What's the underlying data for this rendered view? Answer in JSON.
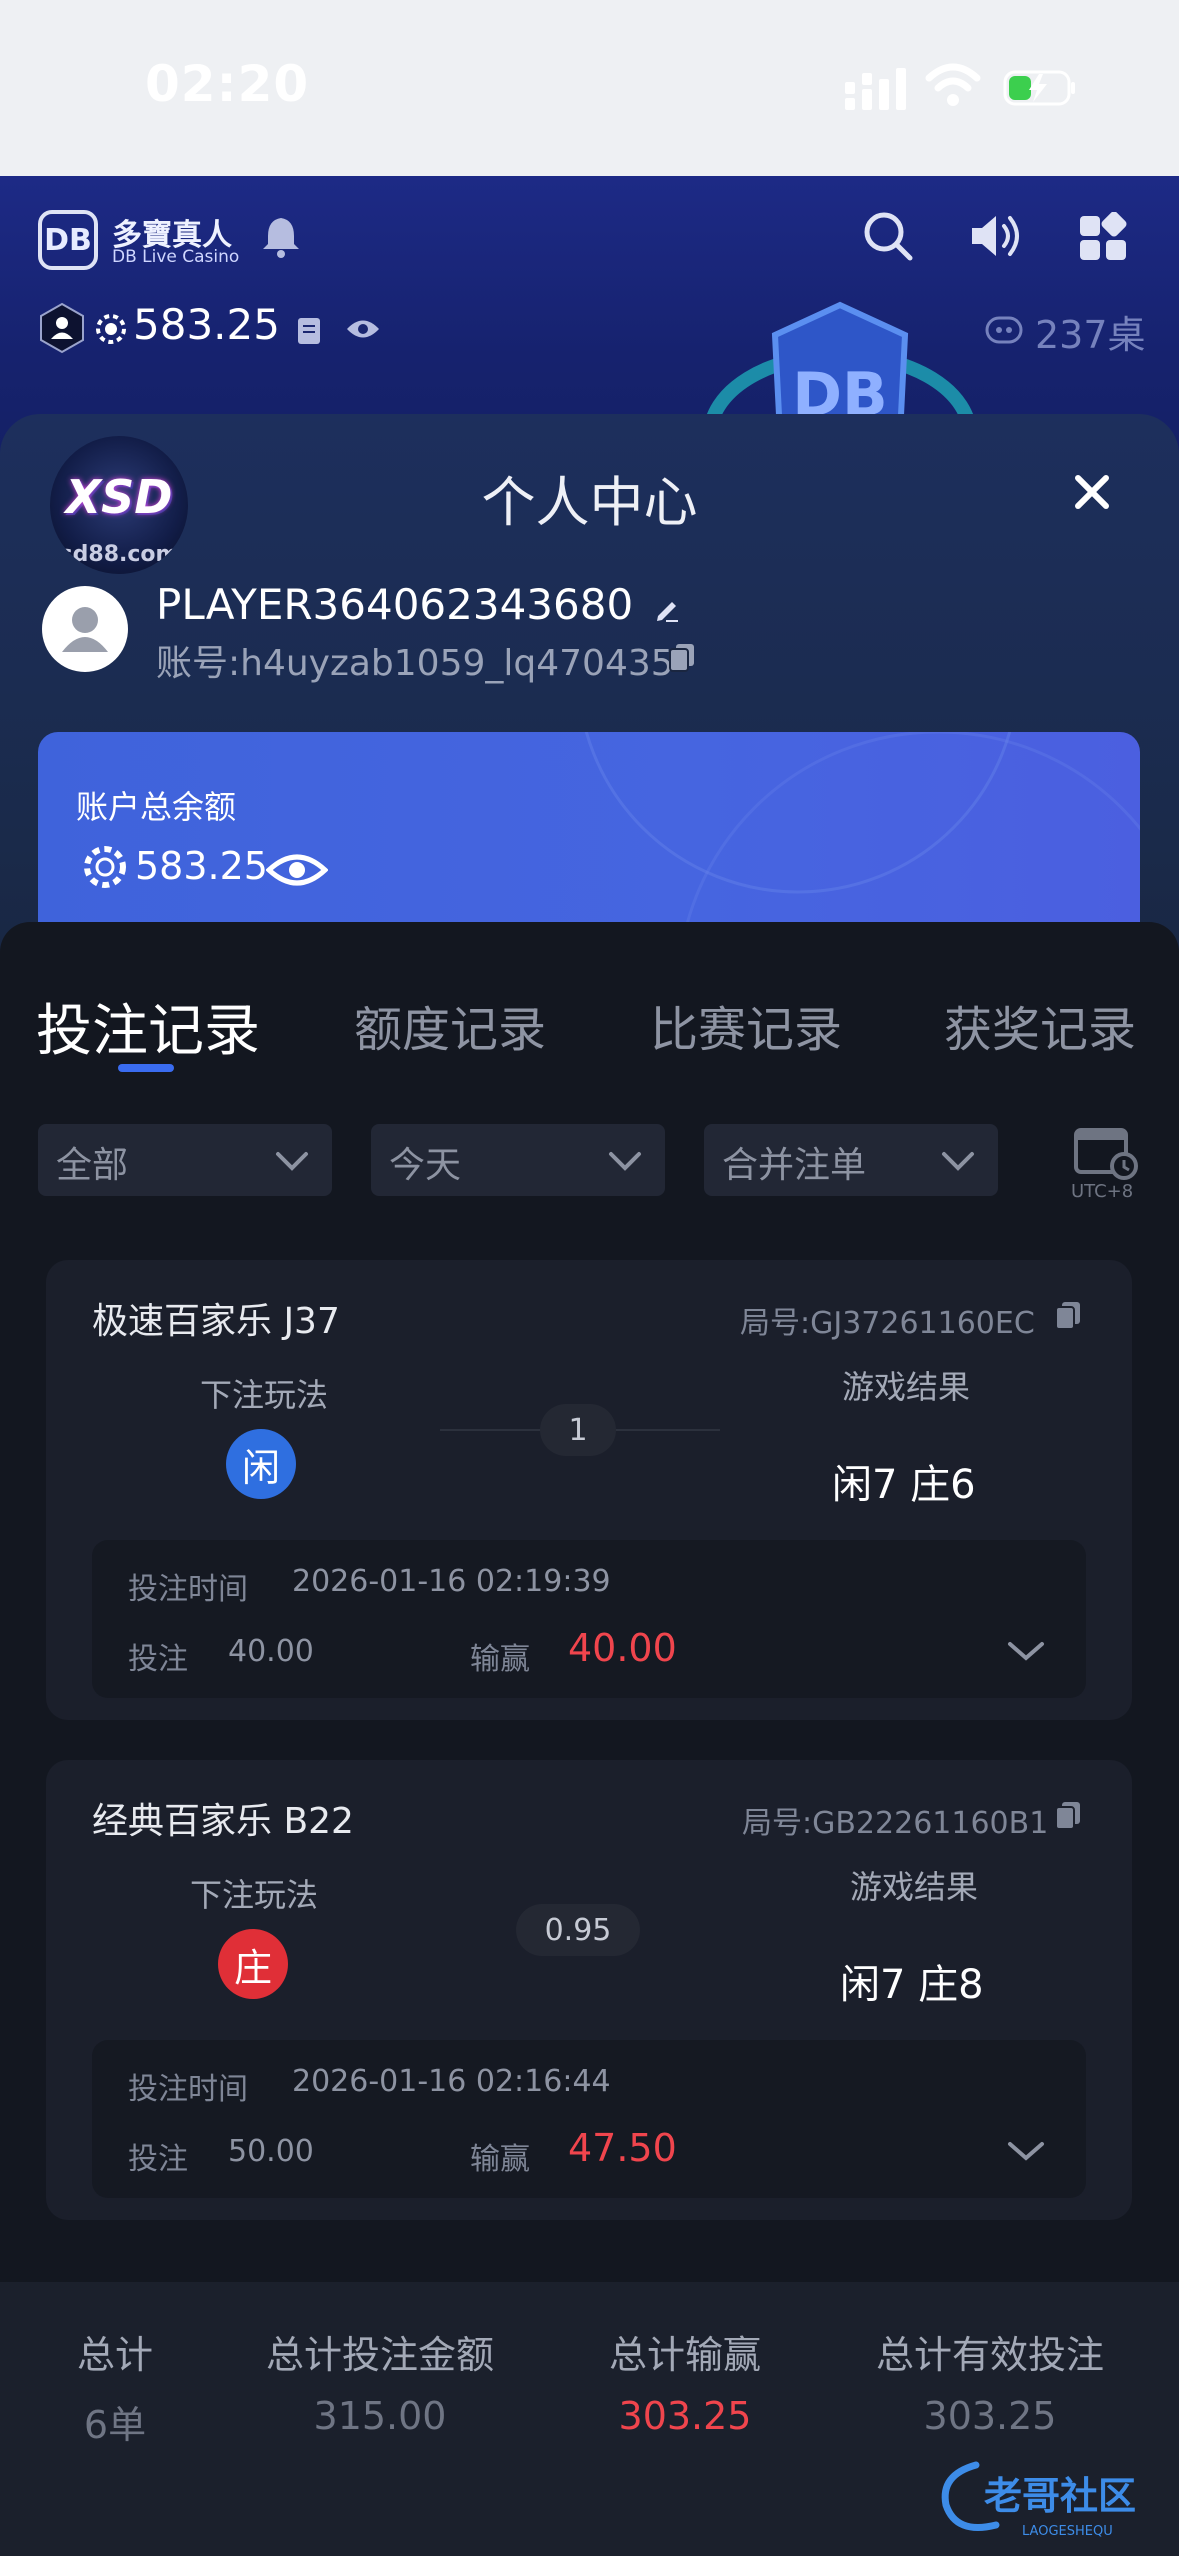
{
  "status_bar": {
    "time": "02:20"
  },
  "app_header": {
    "logo_badge": "DB",
    "logo_cn": "多寶真人",
    "logo_en": "DB Live Casino",
    "balance": "583.25",
    "tables_count": "237桌"
  },
  "modal": {
    "title": "个人中心",
    "brand_logo_text": "XSD",
    "brand_logo_sub": "sd88.com",
    "username": "PLAYER364062343680",
    "account": "账号:h4uyzab1059_lq470435"
  },
  "balance_card": {
    "label": "账户总余额",
    "amount": "583.25"
  },
  "tabs": [
    {
      "label": "投注记录",
      "active": true
    },
    {
      "label": "额度记录",
      "active": false
    },
    {
      "label": "比赛记录",
      "active": false
    },
    {
      "label": "获奖记录",
      "active": false
    }
  ],
  "filters": {
    "type": "全部",
    "date": "今天",
    "merge": "合并注单",
    "timezone": "UTC+8"
  },
  "bets": [
    {
      "game": "极速百家乐 J37",
      "round": "局号:GJ37261160EC",
      "bet_label": "下注玩法",
      "bet_side": "闲",
      "bet_side_color": "#2f6fe0",
      "odds": "1",
      "result_label": "游戏结果",
      "result": "闲7 庄6",
      "time_label": "投注时间",
      "time": "2026-01-16 02:19:39",
      "stake_label": "投注",
      "stake": "40.00",
      "win_label": "输赢",
      "win": "40.00"
    },
    {
      "game": "经典百家乐 B22",
      "round": "局号:GB22261160B1",
      "bet_label": "下注玩法",
      "bet_side": "庄",
      "bet_side_color": "#e02f37",
      "odds": "0.95",
      "result_label": "游戏结果",
      "result": "闲7 庄8",
      "time_label": "投注时间",
      "time": "2026-01-16 02:16:44",
      "stake_label": "投注",
      "stake": "50.00",
      "win_label": "输赢",
      "win": "47.50"
    }
  ],
  "summary": {
    "count_label": "总计",
    "count": "6单",
    "bet_label": "总计投注金额",
    "bet": "315.00",
    "win_label": "总计输赢",
    "win": "303.25",
    "valid_label": "总计有效投注",
    "valid": "303.25"
  },
  "watermark": {
    "text": "老哥社区",
    "sub": "LAOGESHEQU"
  },
  "colors": {
    "accent": "#3a6cf0",
    "loss_win": "#f0454d",
    "player": "#2f6fe0",
    "banker": "#e02f37"
  }
}
